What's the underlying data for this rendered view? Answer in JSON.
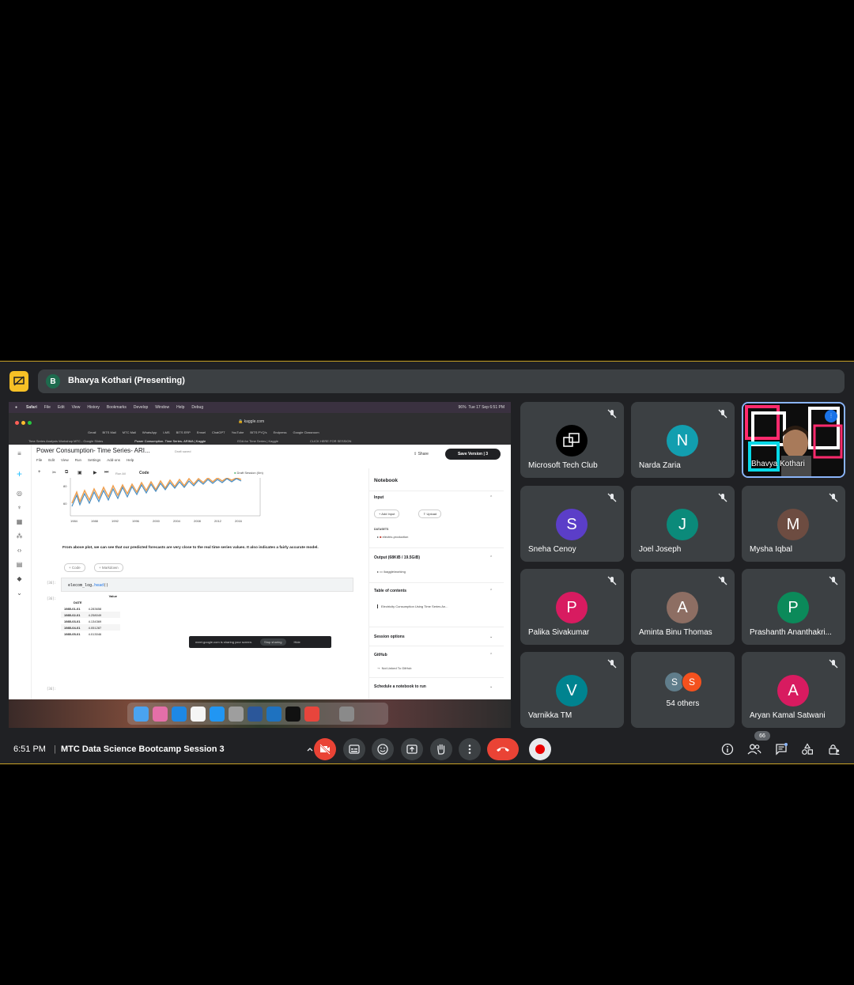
{
  "presenter": {
    "initial": "B",
    "label": "Bhavya Kothari (Presenting)"
  },
  "mac": {
    "menu": [
      "Safari",
      "File",
      "Edit",
      "View",
      "History",
      "Bookmarks",
      "Develop",
      "Window",
      "Help",
      "Debug"
    ],
    "status": "Tue 17 Sep 6:51 PM",
    "battery": "96%"
  },
  "browser": {
    "url": "kaggle.com",
    "bookmarks": [
      "Gmail",
      "BITS Mail",
      "MTC Mail",
      "WhatsApp",
      "LMS",
      "BITS ERP",
      "Emsel",
      "ChatGPT",
      "YouTube",
      "BITS PYQ's",
      "Endpress",
      "Google Classroom"
    ],
    "tabs": [
      "Time Series Analysis Workshop MTC - Google Slides",
      "Power Consumption- Time Series- ARIMA | Kaggle",
      "EDA for Time Series | Kaggle",
      "CLICK HERE FOR SESSION"
    ]
  },
  "kaggle": {
    "title": "Power Consumption- Time Series- ARI...",
    "saved": "Draft saved",
    "menu": [
      "File",
      "Edit",
      "View",
      "Run",
      "Settings",
      "Add-ons",
      "Help"
    ],
    "share": "Share",
    "save_version": "Save Version",
    "version_count": "3",
    "run_all": "Run All",
    "cell_type": "Code",
    "session": "Draft Session (0m)",
    "chart_years": [
      "1984",
      "1988",
      "1992",
      "1996",
      "2000",
      "2004",
      "2008",
      "2012",
      "2016"
    ],
    "chart_yticks": [
      "80",
      "60"
    ],
    "markdown": "From above plot, we can see that our predicted forecasts are very close to the real time series values. It also indicates a fairly accurate model.",
    "add_code": "+ Code",
    "add_markdown": "+ Markdown",
    "cell_in": "[36]:",
    "cell_out": "[36]:",
    "cell_next": "[36]:",
    "code_var": "elecom_log.",
    "code_fn": "head",
    "code_tail": "()",
    "df_header": "Value",
    "df_index": "DATE",
    "df_rows": [
      {
        "date": "1985-01-01",
        "value": "4.283658"
      },
      {
        "date": "1985-02-01",
        "value": "4.258049"
      },
      {
        "date": "1985-03-01",
        "value": "4.134369"
      },
      {
        "date": "1985-04-01",
        "value": "4.051287"
      },
      {
        "date": "1985-05-01",
        "value": "4.013046"
      }
    ],
    "panel": {
      "title": "Notebook",
      "input": "Input",
      "add_input": "+ Add Input",
      "upload": "Upload",
      "datasets": "DATASETS",
      "dataset_name": "electric-production",
      "output": "Output (68KiB / 19.5GiB)",
      "output_path": "/kaggle/working",
      "toc": "Table of contents",
      "toc_item": "Electricity Consumption Using Time Series An...",
      "session_options": "Session options",
      "github": "GitHub",
      "github_status": "Not Linked To GitHub",
      "schedule": "Schedule a notebook to run"
    }
  },
  "sharing_toast": {
    "text": "meet.google.com is sharing your screen.",
    "stop": "Stop sharing",
    "hide": "Hide"
  },
  "participants": [
    {
      "name": "Microsoft Tech Club",
      "initial": "",
      "color": "#000000"
    },
    {
      "name": "Narda Zaria",
      "initial": "N",
      "color": "#129eaf"
    },
    {
      "name": "Bhavya Kothari",
      "initial": "",
      "color": "#000000"
    },
    {
      "name": "Sneha Cenoy",
      "initial": "S",
      "color": "#5b3ec8"
    },
    {
      "name": "Joel Joseph",
      "initial": "J",
      "color": "#0b8a7a"
    },
    {
      "name": "Mysha Iqbal",
      "initial": "M",
      "color": "#6d4c41"
    },
    {
      "name": "Palika Sivakumar",
      "initial": "P",
      "color": "#d81b60"
    },
    {
      "name": "Aminta Binu Thomas",
      "initial": "A",
      "color": "#8d6e63"
    },
    {
      "name": "Prashanth Ananthakri...",
      "initial": "P",
      "color": "#0b8a5a"
    },
    {
      "name": "Varnikka TM",
      "initial": "V",
      "color": "#00838f"
    },
    {
      "name": "54 others",
      "initial": "S",
      "color": "#607d8b"
    },
    {
      "name": "Aryan Kamal Satwani",
      "initial": "A",
      "color": "#d81b60"
    }
  ],
  "others_second_initial": "S",
  "bottom": {
    "time": "6:51 PM",
    "separator": "|",
    "meeting_name": "MTC Data Science Bootcamp Session 3",
    "participant_count": "66"
  },
  "colors": {
    "bg": "#202124",
    "tile": "#3c4043",
    "end_call": "#ea4335",
    "accent": "#8ab4f8",
    "presenting": "#f6c026"
  }
}
